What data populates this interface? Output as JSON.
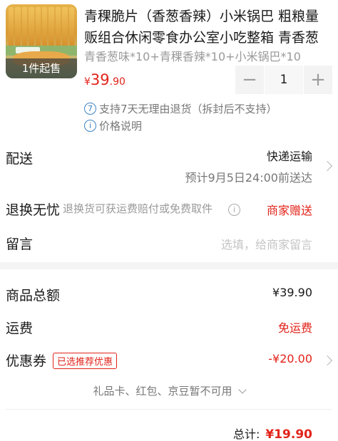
{
  "product": {
    "thumb_overlay": "1件起售",
    "title": "青稞脆片（香葱香辣）小米锅巴 粗粮量贩组合休闲零食办公室小吃整箱 青香葱味…",
    "spec": "青香葱味*10+青稞香辣*10+小米锅巴*10",
    "price_symbol": "¥",
    "price_int": "39",
    "price_dec": ".90",
    "quantity": "1",
    "minus_label": "−",
    "plus_label": "+",
    "note_return_icon": "7",
    "note_return": "支持7天无理由退货（拆封后不支持）",
    "note_price_icon": "i",
    "note_price": "价格说明"
  },
  "shipping": {
    "label": "配送",
    "method": "快递运输",
    "eta": "预计9月5日24:00前送达"
  },
  "returns": {
    "label": "退换无忧",
    "desc": "退换货可获运费赔付或免费取件",
    "info_icon": "i",
    "value": "商家赠送"
  },
  "message": {
    "label": "留言",
    "placeholder": "选填，给商家留言"
  },
  "summary": {
    "subtotal_label": "商品总额",
    "subtotal_value": "¥39.90",
    "freight_label": "运费",
    "freight_value": "免运费",
    "coupon_label": "优惠券",
    "coupon_badge": "已选推荐优惠",
    "coupon_value": "-¥20.00",
    "gift_note": "礼品卡、红包、京豆暂不可用",
    "total_label": "总计:",
    "total_value": "¥19.90"
  },
  "colors": {
    "accent_red": "#e2231a",
    "info_blue": "#3c83c4"
  },
  "icons": [
    "minus-icon",
    "plus-icon",
    "return-policy-icon",
    "info-icon",
    "chevron-right-icon",
    "chevron-down-icon"
  ]
}
